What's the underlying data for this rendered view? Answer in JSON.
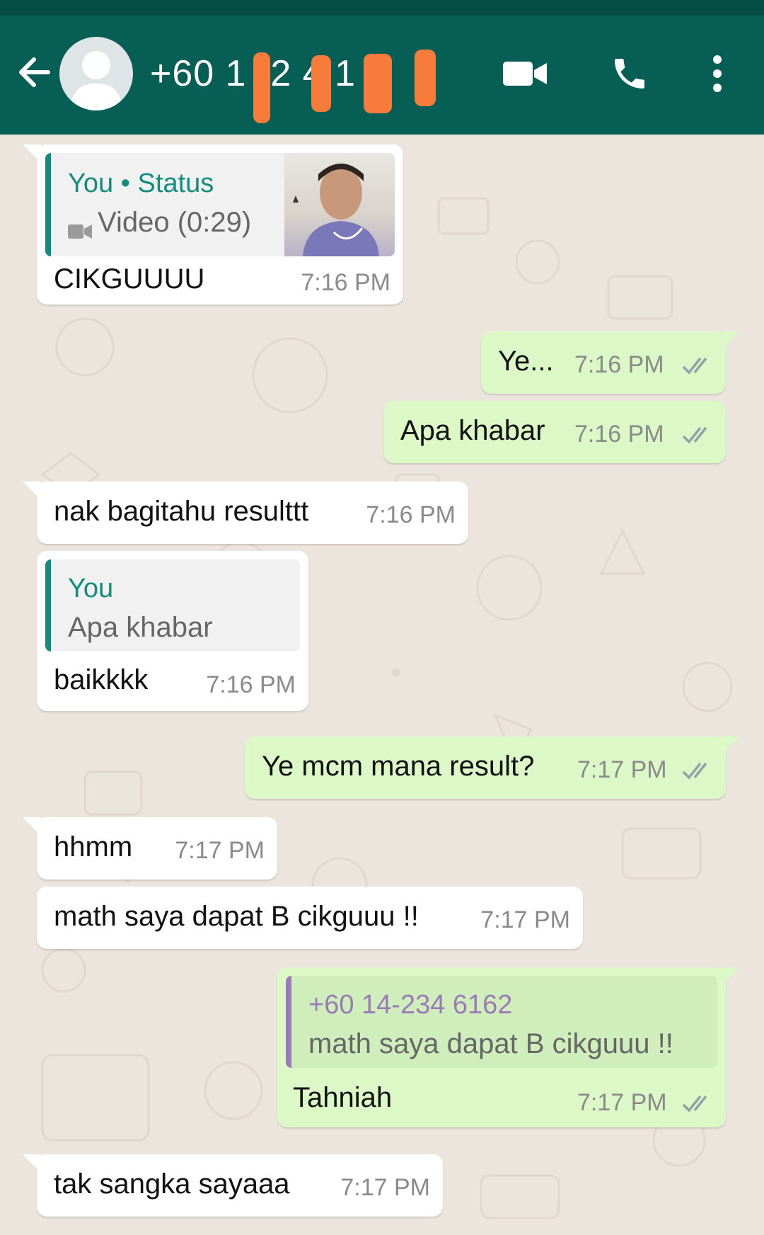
{
  "header": {
    "contact_name": "+60 1 -2 4 1 2",
    "icons": [
      "back-arrow-icon",
      "avatar-icon",
      "video-call-icon",
      "voice-call-icon",
      "more-options-icon"
    ]
  },
  "colors": {
    "header": "#075e54",
    "incoming_bubble": "#ffffff",
    "outgoing_bubble": "#dcf8c6",
    "quote_accent_you": "#128c7e",
    "quote_accent_contact": "#9b7bb6",
    "read_ticks": "#8fa3a8",
    "chat_background": "#ece5dd"
  },
  "messages": [
    {
      "direction": "in",
      "quote": {
        "author": "You • Status",
        "text": "Video (0:29)"
      },
      "text": "CIKGUUUU",
      "time": "7:16 PM"
    },
    {
      "direction": "out",
      "text": "Ye...",
      "time": "7:16 PM",
      "status": "read"
    },
    {
      "direction": "out",
      "text": "Apa khabar",
      "time": "7:16 PM",
      "status": "read"
    },
    {
      "direction": "in",
      "text": "nak bagitahu resulttt",
      "time": "7:16 PM"
    },
    {
      "direction": "in",
      "quote": {
        "author": "You",
        "text": "Apa khabar"
      },
      "text": "baikkkk",
      "time": "7:16 PM"
    },
    {
      "direction": "out",
      "text": "Ye mcm mana result?",
      "time": "7:17 PM",
      "status": "read"
    },
    {
      "direction": "in",
      "text": "hhmm",
      "time": "7:17 PM"
    },
    {
      "direction": "in",
      "text": "math saya dapat B cikguuu !!",
      "time": "7:17 PM"
    },
    {
      "direction": "out",
      "quote": {
        "author": "+60 14-234 6162",
        "text": "math saya dapat B cikguuu !!"
      },
      "text": "Tahniah",
      "time": "7:17 PM",
      "status": "read"
    },
    {
      "direction": "in",
      "text": "tak sangka sayaaa",
      "time": "7:17 PM"
    }
  ]
}
